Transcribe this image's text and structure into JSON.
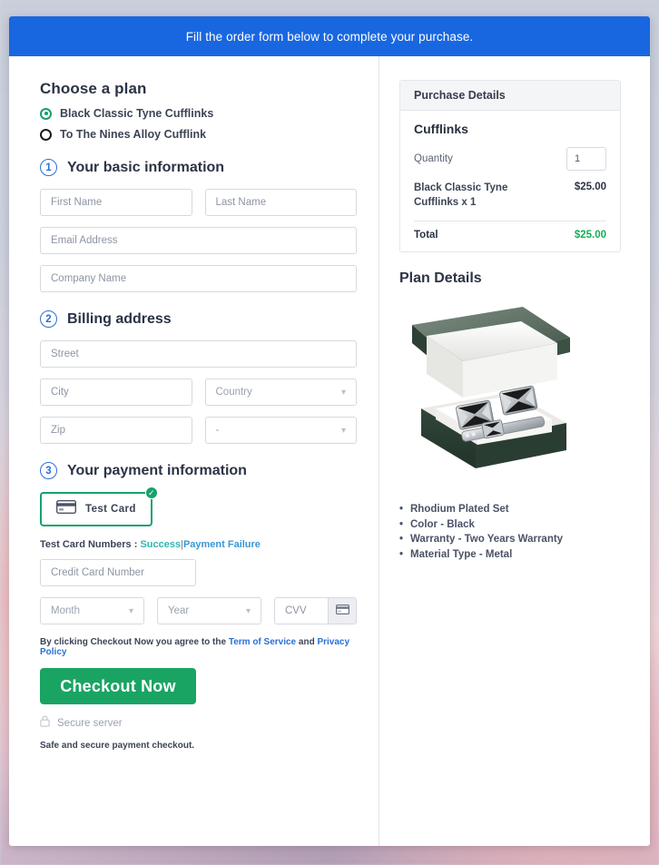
{
  "banner": {
    "text": "Fill the order form below to complete your purchase."
  },
  "plans": {
    "heading": "Choose a plan",
    "options": [
      {
        "label": "Black Classic Tyne Cufflinks",
        "selected": true
      },
      {
        "label": "To The Nines Alloy Cufflink",
        "selected": false
      }
    ]
  },
  "steps": {
    "basic": {
      "number": "1",
      "title": "Your basic information"
    },
    "billing": {
      "number": "2",
      "title": "Billing address"
    },
    "payment": {
      "number": "3",
      "title": "Your payment information"
    }
  },
  "fields": {
    "first_name": {
      "placeholder": "First Name",
      "value": ""
    },
    "last_name": {
      "placeholder": "Last Name",
      "value": ""
    },
    "email": {
      "placeholder": "Email Address",
      "value": ""
    },
    "company": {
      "placeholder": "Company Name",
      "value": ""
    },
    "street": {
      "placeholder": "Street",
      "value": ""
    },
    "city": {
      "placeholder": "City",
      "value": ""
    },
    "country": {
      "placeholder": "Country",
      "value": "Country"
    },
    "zip": {
      "placeholder": "Zip",
      "value": ""
    },
    "state": {
      "placeholder": "-",
      "value": "-"
    },
    "card_number": {
      "placeholder": "Credit Card Number",
      "value": ""
    },
    "month": {
      "placeholder": "Month",
      "value": "Month"
    },
    "year": {
      "placeholder": "Year",
      "value": "Year"
    },
    "cvv": {
      "placeholder": "CVV",
      "value": ""
    }
  },
  "payment": {
    "card_tile_label": "Test Card",
    "card_tile_selected": true,
    "test_numbers_prefix": "Test Card Numbers :",
    "success_link": "Success",
    "separator": "|",
    "failure_link": "Payment Failure"
  },
  "terms": {
    "prefix": "By clicking Checkout Now you agree to the",
    "tos_link": "Term of Service",
    "and": "and",
    "privacy_link": "Privacy Policy"
  },
  "actions": {
    "checkout_label": "Checkout Now",
    "secure_label": "Secure server",
    "safe_note": "Safe and secure payment checkout."
  },
  "purchase": {
    "header": "Purchase Details",
    "product": "Cufflinks",
    "quantity_label": "Quantity",
    "quantity_value": "1",
    "line_item_desc": "Black Classic Tyne Cufflinks x 1",
    "line_item_amount": "$25.00",
    "total_label": "Total",
    "total_amount": "$25.00"
  },
  "plan_details": {
    "title": "Plan Details",
    "image_alt": "cufflink-gift-box-image",
    "features": [
      "Rhodium Plated Set",
      "Color - Black",
      "Warranty - Two Years Warranty",
      "Material Type - Metal"
    ]
  },
  "colors": {
    "banner_blue": "#1967e0",
    "accent_green": "#1aa463",
    "total_green": "#13b05a",
    "step_blue": "#2a6fd6",
    "link_teal": "#2fb5b0"
  }
}
